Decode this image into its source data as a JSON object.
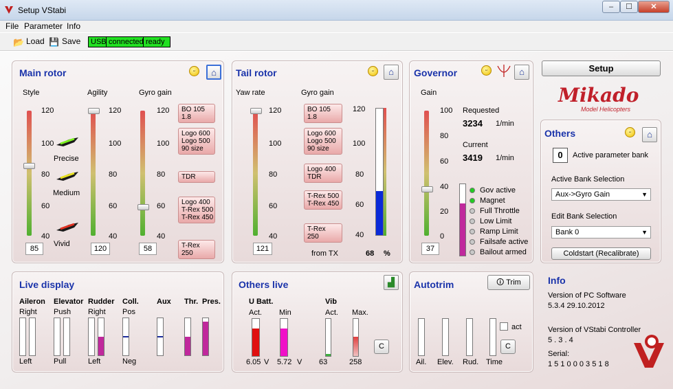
{
  "window": {
    "title": "Setup VStabi",
    "minimize": "–",
    "maximize": "☐",
    "close": "✕"
  },
  "menu": [
    "File",
    "Parameter",
    "Info"
  ],
  "toolbar": {
    "load_label": "Load",
    "save_label": "Save",
    "status": [
      "USB",
      "connected",
      "ready"
    ]
  },
  "main_rotor": {
    "title": "Main rotor",
    "style": {
      "label": "Style",
      "ticks": [
        "120",
        "100",
        "80",
        "60",
        "40"
      ],
      "value": "85",
      "modes": [
        "Precise",
        "Medium",
        "Vivid"
      ]
    },
    "agility": {
      "label": "Agility",
      "ticks": [
        "120",
        "100",
        "80",
        "60",
        "40"
      ],
      "value": "120"
    },
    "gyro": {
      "label": "Gyro gain",
      "ticks": [
        "120",
        "100",
        "80",
        "60",
        "40"
      ],
      "value": "58",
      "presets": [
        "BO 105 1.8",
        "Logo 600\nLogo 500\n90 size",
        "TDR",
        "Logo 400\nT-Rex 500\nT-Rex 450",
        "T-Rex 250"
      ]
    }
  },
  "tail_rotor": {
    "title": "Tail rotor",
    "yaw": {
      "label": "Yaw rate",
      "ticks": [
        "120",
        "100",
        "80",
        "60",
        "40"
      ],
      "value": "121"
    },
    "gyro": {
      "label": "Gyro gain",
      "ticks": [
        "120",
        "100",
        "80",
        "60",
        "40"
      ],
      "presets": [
        "BO 105 1.8",
        "Logo 600\nLogo 500\n90 size",
        "Logo 400\nTDR",
        "T-Rex 500\nT-Rex 450",
        "T-Rex 250"
      ]
    },
    "from_tx_label": "from TX",
    "from_tx_value": "68",
    "from_tx_unit": "%"
  },
  "governor": {
    "title": "Governor",
    "gain": {
      "label": "Gain",
      "ticks": [
        "100",
        "80",
        "60",
        "40",
        "20",
        "0"
      ],
      "value": "37"
    },
    "requested_label": "Requested",
    "requested_value": "3234",
    "requested_unit": "1/min",
    "current_label": "Current",
    "current_value": "3419",
    "current_unit": "1/min",
    "indicators": [
      {
        "label": "Gov active",
        "color": "#22cc22"
      },
      {
        "label": "Magnet",
        "color": "#22cc22"
      },
      {
        "label": "Full Throttle",
        "color": "#c8c8c8"
      },
      {
        "label": "Low Limit",
        "color": "#c8c8c8"
      },
      {
        "label": "Ramp Limit",
        "color": "#c8c8c8"
      },
      {
        "label": "Failsafe active",
        "color": "#c8c8c8"
      },
      {
        "label": "Bailout armed",
        "color": "#c8c8c8"
      }
    ]
  },
  "right": {
    "setup_label": "Setup",
    "logo_text": "Mikado",
    "logo_sub": "Model Helicopters",
    "others_title": "Others",
    "active_bank_value": "0",
    "active_bank_label": "Active parameter bank",
    "active_sel_label": "Active Bank Selection",
    "active_sel_value": "Aux->Gyro Gain",
    "edit_sel_label": "Edit Bank Selection",
    "edit_sel_value": "Bank 0",
    "coldstart_label": "Coldstart (Recalibrate)",
    "info_title": "Info",
    "pc_label": "Version of PC Software",
    "pc_value": "5.3.4  29.10.2012",
    "ctrl_label": "Version of VStabi Controller",
    "ctrl_value": "5 . 3 . 4",
    "serial_label": "Serial:",
    "serial_value": "1 5 1 0 0 0 3 5 1 8"
  },
  "live_display": {
    "title": "Live display",
    "channels": [
      {
        "name": "Aileron",
        "top": "Right",
        "bottom": "Left"
      },
      {
        "name": "Elevator",
        "top": "Push",
        "bottom": "Pull"
      },
      {
        "name": "Rudder",
        "top": "Right",
        "bottom": "Left"
      },
      {
        "name": "Coll.",
        "top": "Pos",
        "bottom": "Neg"
      },
      {
        "name": "Aux",
        "top": "",
        "bottom": ""
      },
      {
        "name": "Thr.",
        "top": "",
        "bottom": ""
      },
      {
        "name": "Pres.",
        "top": "",
        "bottom": ""
      }
    ]
  },
  "others_live": {
    "title": "Others live",
    "ubatt_label": "U Batt.",
    "act_label": "Act.",
    "min_label": "Min",
    "act_value": "6.05",
    "act_unit": "V",
    "min_value": "5.72",
    "min_unit": "V",
    "vib_label": "Vib",
    "vib_act_label": "Act.",
    "vib_max_label": "Max.",
    "vib_act_value": "63",
    "vib_max_value": "258",
    "clear_label": "C"
  },
  "autotrim": {
    "title": "Autotrim",
    "trim_label": "Trim",
    "axes": [
      "Ail.",
      "Elev.",
      "Rud.",
      "Time"
    ],
    "act_label": "act",
    "clear_label": "C"
  }
}
